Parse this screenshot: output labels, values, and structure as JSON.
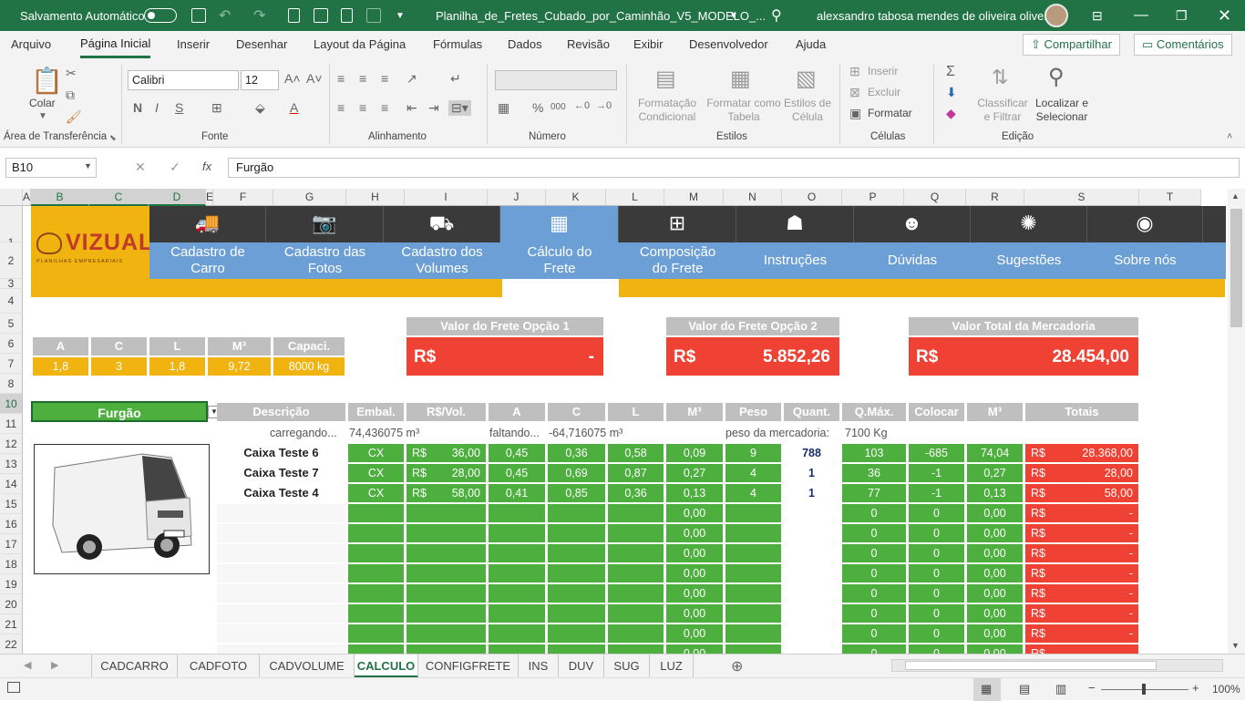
{
  "titlebar": {
    "autosave_label": "Salvamento Automático",
    "filename": "Planilha_de_Fretes_Cubado_por_Caminhão_V5_MODELO_...",
    "user": "alexsandro tabosa mendes de oliveira oliveira"
  },
  "menu": {
    "tabs": [
      "Arquivo",
      "Página Inicial",
      "Inserir",
      "Desenhar",
      "Layout da Página",
      "Fórmulas",
      "Dados",
      "Revisão",
      "Exibir",
      "Desenvolvedor",
      "Ajuda"
    ],
    "share": "Compartilhar",
    "comments": "Comentários"
  },
  "ribbon": {
    "paste": "Colar",
    "font_name": "Calibri",
    "font_size": "12",
    "cond_format": "Formatação Condicional",
    "format_table": "Formatar como Tabela",
    "cell_styles": "Estilos de Célula",
    "insert": "Inserir",
    "delete": "Excluir",
    "format": "Formatar",
    "sort_filter": "Classificar e Filtrar",
    "find_select": "Localizar e Selecionar",
    "groups": {
      "clipboard": "Área de Transferência",
      "font": "Fonte",
      "alignment": "Alinhamento",
      "number": "Número",
      "styles": "Estilos",
      "cells": "Células",
      "editing": "Edição"
    }
  },
  "formula": {
    "namebox": "B10",
    "content": "Furgão"
  },
  "columns": [
    {
      "l": "A"
    },
    {
      "l": "B"
    },
    {
      "l": "C"
    },
    {
      "l": "D"
    },
    {
      "l": "E"
    },
    {
      "l": "F"
    },
    {
      "l": "G"
    },
    {
      "l": "H"
    },
    {
      "l": "I"
    },
    {
      "l": "J"
    },
    {
      "l": "K"
    },
    {
      "l": "L"
    },
    {
      "l": "M"
    },
    {
      "l": "N"
    },
    {
      "l": "O"
    },
    {
      "l": "P"
    },
    {
      "l": "Q"
    },
    {
      "l": "R"
    },
    {
      "l": "S"
    },
    {
      "l": "T"
    }
  ],
  "rows": [
    "1",
    "2",
    "3",
    "4",
    "5",
    "6",
    "7",
    "8",
    "10",
    "11",
    "12",
    "13",
    "14",
    "15",
    "16",
    "17",
    "18",
    "19",
    "20",
    "21",
    "22"
  ],
  "logo": {
    "text": "VIZUAL",
    "sub": "PLANILHAS EMPRESARIAIS"
  },
  "nav": [
    {
      "label": "Cadastro de Carro",
      "icon": "truck-icon"
    },
    {
      "label": "Cadastro das Fotos",
      "icon": "camera-icon"
    },
    {
      "label": "Cadastro dos Volumes",
      "icon": "hand-truck-icon"
    },
    {
      "label": "Cálculo do Frete",
      "icon": "calculator-icon"
    },
    {
      "label": "Composição do Frete",
      "icon": "math-symbols-icon"
    },
    {
      "label": "Instruções",
      "icon": "presentation-icon"
    },
    {
      "label": "Dúvidas",
      "icon": "question-person-icon"
    },
    {
      "label": "Sugestões",
      "icon": "lightbulb-icon"
    },
    {
      "label": "Sobre nós",
      "icon": "owl-icon"
    }
  ],
  "dims": {
    "headers": [
      "A",
      "C",
      "L",
      "M³",
      "Capaci."
    ],
    "values": [
      "1,8",
      "3",
      "1,8",
      "9,72",
      "8000 kg"
    ]
  },
  "freight": [
    {
      "title": "Valor do Frete Opção 1",
      "currency": "R$",
      "value": "-"
    },
    {
      "title": "Valor do Frete Opção 2",
      "currency": "R$",
      "value": "5.852,26"
    },
    {
      "title": "Valor Total da Mercadoria",
      "currency": "R$",
      "value": "28.454,00"
    }
  ],
  "vehicle": "Furgão",
  "table": {
    "headers": [
      "Descrição",
      "Embal.",
      "R$/Vol.",
      "A",
      "C",
      "L",
      "M³",
      "Peso",
      "Quant.",
      "Q.Máx.",
      "Colocar",
      "M³",
      "Totais"
    ],
    "info": {
      "loading": "carregando...",
      "loading_val": "74,436075 m³",
      "missing": "faltando...",
      "missing_val": "-64,716075 m³",
      "weight_label": "peso da mercadoria:",
      "weight_val": "7100 Kg"
    },
    "items": [
      {
        "desc": "Caixa Teste 6",
        "emb": "CX",
        "cur": "R$",
        "price": "36,00",
        "a": "0,45",
        "c": "0,36",
        "l": "0,58",
        "m3": "0,09",
        "peso": "9",
        "qt": "788",
        "qmax": "103",
        "col": "-685",
        "m3b": "74,04",
        "tcur": "R$",
        "total": "28.368,00"
      },
      {
        "desc": "Caixa Teste 7",
        "emb": "CX",
        "cur": "R$",
        "price": "28,00",
        "a": "0,45",
        "c": "0,69",
        "l": "0,87",
        "m3": "0,27",
        "peso": "4",
        "qt": "1",
        "qmax": "36",
        "col": "-1",
        "m3b": "0,27",
        "tcur": "R$",
        "total": "28,00"
      },
      {
        "desc": "Caixa Teste 4",
        "emb": "CX",
        "cur": "R$",
        "price": "58,00",
        "a": "0,41",
        "c": "0,85",
        "l": "0,36",
        "m3": "0,13",
        "peso": "4",
        "qt": "1",
        "qmax": "77",
        "col": "-1",
        "m3b": "0,13",
        "tcur": "R$",
        "total": "58,00"
      }
    ],
    "empty_row": {
      "m3": "0,00",
      "qmax": "0",
      "col": "0",
      "m3b": "0,00",
      "tcur": "R$",
      "total": "-"
    }
  },
  "sheets": [
    "CADCARRO",
    "CADFOTO",
    "CADVOLUME",
    "CALCULO",
    "CONFIGFRETE",
    "INS",
    "DUV",
    "SUG",
    "LUZ"
  ],
  "active_sheet": "CALCULO",
  "status": {
    "zoom": "100%"
  }
}
